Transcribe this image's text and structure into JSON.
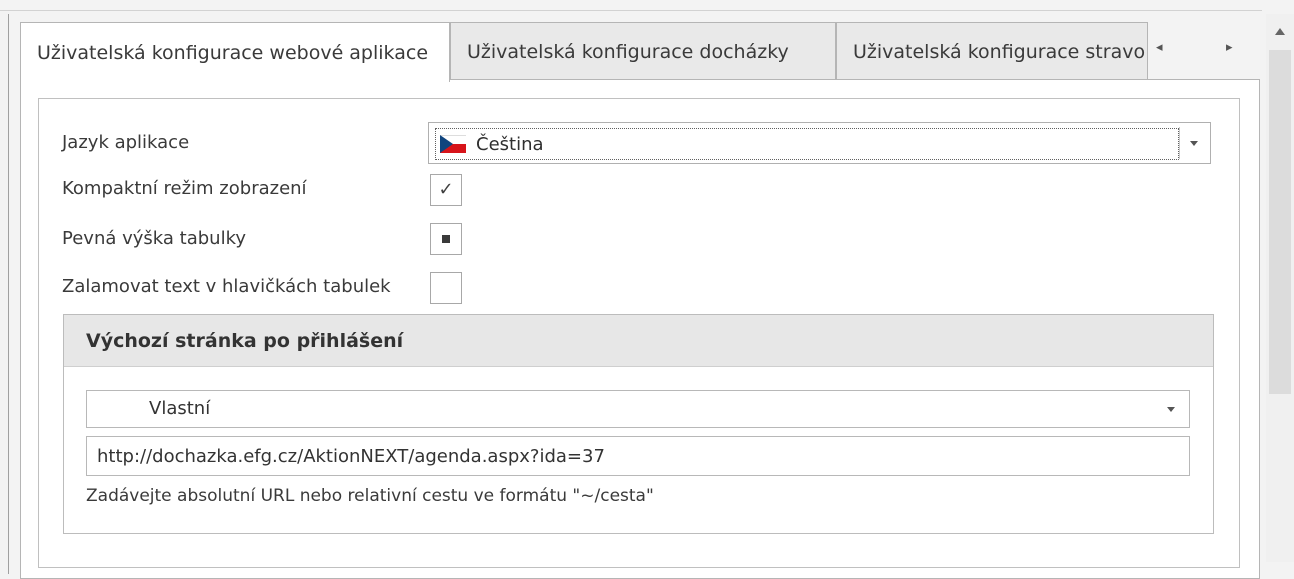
{
  "tabs": [
    {
      "label": "Uživatelská konfigurace webové aplikace",
      "active": true
    },
    {
      "label": "Uživatelská konfigurace docházky",
      "active": false
    },
    {
      "label": "Uživatelská konfigurace stravo",
      "active": false
    }
  ],
  "tab_nav": {
    "prev_icon": "◂",
    "next_icon": "▸"
  },
  "settings": {
    "language": {
      "label": "Jazyk aplikace",
      "value": "Čeština",
      "flag_icon": "czech-flag-icon"
    },
    "compact_mode": {
      "label": "Kompaktní režim zobrazení",
      "state": "checked",
      "mark": "✓"
    },
    "fixed_height": {
      "label": "Pevná výška tabulky",
      "state": "indeterminate"
    },
    "wrap_headers": {
      "label": "Zalamovat text v hlavičkách tabulek",
      "state": "unchecked"
    }
  },
  "start_page": {
    "title": "Výchozí stránka po přihlášení",
    "mode_value": "Vlastní",
    "url_value": "http://dochazka.efg.cz/AktionNEXT/agenda.aspx?ida=37",
    "hint": "Zadávejte absolutní URL nebo relativní cestu ve formátu \"~/cesta\""
  },
  "colors": {
    "flag_blue": "#11457e",
    "flag_red": "#d7141a",
    "panel_bg": "#ffffff",
    "window_bg": "#f3f3f3"
  }
}
